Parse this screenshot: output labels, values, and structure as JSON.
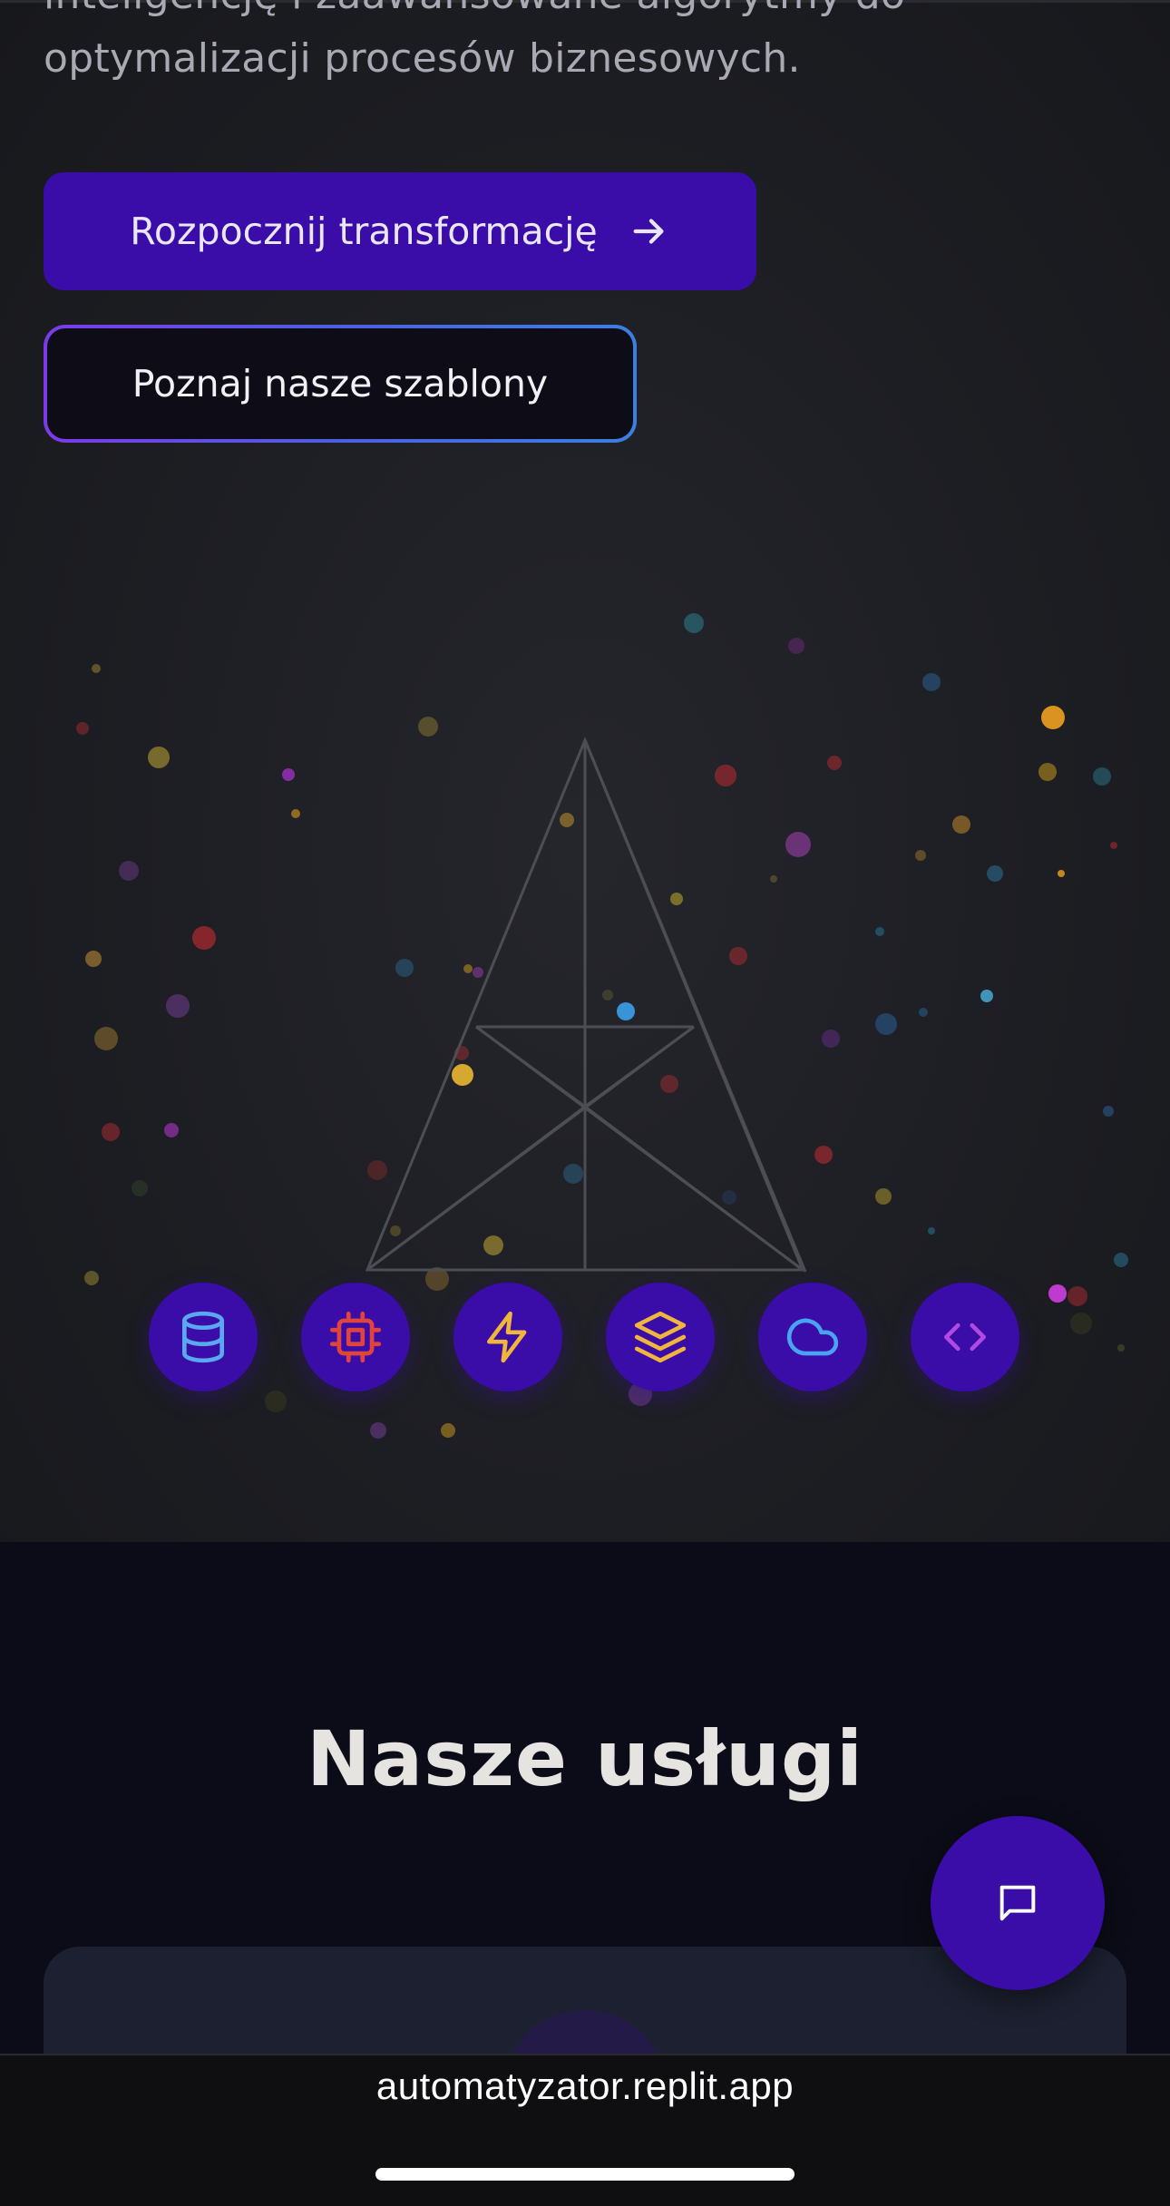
{
  "hero": {
    "intro_line_1": "inteligencję i zaawansowane algorytmy do",
    "intro_line_2": "optymalizacji procesów biznesowych.",
    "primary_button_label": "Rozpocznij transformację",
    "secondary_button_label": "Poznaj nasze szablony",
    "tech_icons": [
      {
        "name": "database-icon",
        "color": "#5aa9f0"
      },
      {
        "name": "cpu-icon",
        "color": "#e0453c"
      },
      {
        "name": "lightning-icon",
        "color": "#f0b53c"
      },
      {
        "name": "layers-icon",
        "color": "#f0b53c"
      },
      {
        "name": "cloud-icon",
        "color": "#4aa3f0"
      },
      {
        "name": "code-icon",
        "color": "#b14ae0"
      }
    ]
  },
  "services": {
    "title": "Nasze usługi"
  },
  "chat": {
    "icon": "chat-bubble-icon"
  },
  "browser": {
    "url": "automatyzator.replit.app"
  },
  "colors": {
    "accent": "#3a0ca8",
    "background": "#1b1c21",
    "services_background": "#0c0c18"
  }
}
